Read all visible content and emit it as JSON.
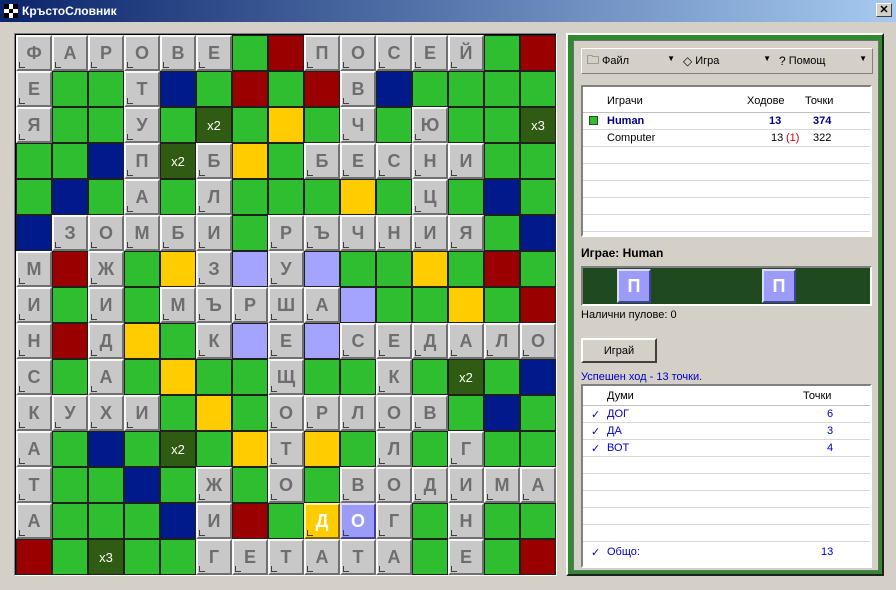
{
  "window": {
    "title": "КръстоСловник",
    "close_label": "✕"
  },
  "colors": {
    "bonus_green": "#2fbe2f",
    "dark_blue": "#001a8c",
    "dark_red": "#9b0000",
    "yellow": "#ffcc00",
    "lavender": "#a4a4ff",
    "dark_green": "#2f5b12",
    "tile": "#c8c8c8"
  },
  "board": {
    "rows": [
      [
        "Ф",
        "А",
        "Р",
        "О",
        "В",
        "Е",
        ".",
        "R",
        "П",
        "О",
        "С",
        "Е",
        "Й",
        ".",
        "R"
      ],
      [
        "Е",
        ".",
        ".",
        "Т",
        "B",
        ".",
        "R",
        ".",
        "R",
        "В",
        "B",
        ".",
        ".",
        ".",
        "."
      ],
      [
        "Я",
        ".",
        ".",
        "У",
        ".",
        "x2",
        ".",
        "Y",
        ".",
        "Ч",
        ".",
        "Ю",
        ".",
        ".",
        "x3"
      ],
      [
        ".",
        ".",
        "B",
        "П",
        "x2",
        "Б",
        "Y",
        ".",
        "Б",
        "Е",
        "С",
        "Н",
        "И",
        ".",
        "."
      ],
      [
        ".",
        "B",
        ".",
        "А",
        ".",
        "Л",
        ".",
        ".",
        ".",
        "Y",
        ".",
        "Ц",
        ".",
        "B",
        "."
      ],
      [
        "B",
        "З",
        "О",
        "М",
        "Б",
        "И",
        ".",
        "Р",
        "Ъ",
        "Ч",
        "Н",
        "И",
        "Я",
        ".",
        "B"
      ],
      [
        "М",
        "R",
        "Ж",
        ".",
        "Y",
        "З",
        "L",
        "У",
        "L",
        ".",
        ".",
        "Y",
        ".",
        "R",
        "."
      ],
      [
        "И",
        ".",
        "И",
        ".",
        "М",
        "Ъ",
        "Р",
        "Ш",
        "А",
        "L",
        ".",
        ".",
        "Y",
        ".",
        "R"
      ],
      [
        "Н",
        "R",
        "Д",
        "Y",
        ".",
        "К",
        "L",
        "Е",
        "L",
        "С",
        "Е",
        "Д",
        "А",
        "Л",
        "О"
      ],
      [
        "С",
        ".",
        "А",
        ".",
        "Y",
        ".",
        ".",
        "Щ",
        ".",
        ".",
        "К",
        ".",
        "x2",
        ".",
        "B"
      ],
      [
        "К",
        "У",
        "Х",
        "И",
        ".",
        "Y",
        ".",
        "О",
        "Р",
        "Л",
        "О",
        "В",
        ".",
        "B",
        "."
      ],
      [
        "А",
        ".",
        "B",
        ".",
        "x2",
        ".",
        "Y",
        "Т",
        "Y",
        ".",
        "Л",
        ".",
        "Г",
        ".",
        "."
      ],
      [
        "Т",
        ".",
        ".",
        "B",
        ".",
        "Ж",
        ".",
        "О",
        ".",
        "В",
        "О",
        "Д",
        "И",
        "М",
        "А"
      ],
      [
        "А",
        ".",
        ".",
        ".",
        "B",
        "И",
        "R",
        ".",
        "*Д",
        "+О",
        "Г",
        ".",
        "Н",
        ".",
        "."
      ],
      [
        "R",
        ".",
        "x3",
        ".",
        ".",
        "Г",
        "Е",
        "Т",
        "А",
        "Т",
        "А",
        ".",
        "Е",
        ".",
        "R"
      ]
    ]
  },
  "toolbar": {
    "file": {
      "label": "Файл",
      "icon": "folder-icon"
    },
    "game": {
      "label": "Игра",
      "icon": "gem-icon"
    },
    "help": {
      "label": "Помощ",
      "icon": "help-icon"
    }
  },
  "players": {
    "headers": {
      "name": "Играчи",
      "moves": "Ходове",
      "points": "Точки"
    },
    "rows": [
      {
        "name": "Human",
        "moves": "13",
        "penalty": "",
        "points": "374",
        "active": true
      },
      {
        "name": "Computer",
        "moves": "13",
        "penalty": "(1)",
        "points": "322",
        "active": false
      }
    ]
  },
  "turn": {
    "label": "Играе:",
    "player": "Human"
  },
  "rack": {
    "tiles": [
      "П",
      "П"
    ]
  },
  "available": {
    "label": "Налични пулове:",
    "count": "0"
  },
  "play_button": "Играй",
  "status": "Успешен ход - 13 точки.",
  "words": {
    "headers": {
      "word": "Думи",
      "points": "Точки"
    },
    "rows": [
      {
        "word": "ДОГ",
        "points": "6"
      },
      {
        "word": "ДА",
        "points": "3"
      },
      {
        "word": "ВОТ",
        "points": "4"
      }
    ],
    "total_label": "Общо:",
    "total": "13"
  }
}
